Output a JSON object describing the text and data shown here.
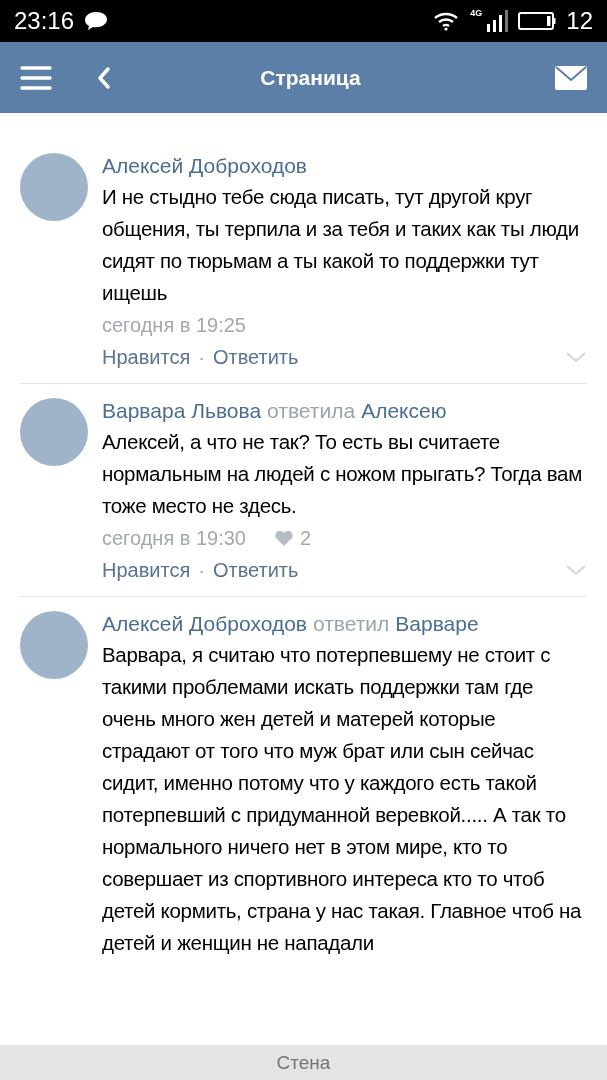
{
  "status_bar": {
    "time": "23:16",
    "network": "4G",
    "battery": "12"
  },
  "header": {
    "title": "Страница"
  },
  "comments": [
    {
      "author": "Алексей Доброходов",
      "text": "И не стыдно тебе сюда писать, тут другой круг общения, ты терпила и за тебя и таких как ты люди сидят по тюрьмам а ты какой то поддержки тут ищешь",
      "time": "сегодня в 19:25",
      "like_label": "Нравится",
      "separator": "·",
      "reply_label": "Ответить"
    },
    {
      "author": "Варвара Львова",
      "reply_verb": "ответила",
      "reply_to": "Алексею",
      "text": "Алексей, а что не так? То есть вы считаете нормальным на людей с ножом прыгать? Тогда вам тоже место не здесь.",
      "time": "сегодня в 19:30",
      "likes": "2",
      "like_label": "Нравится",
      "separator": "·",
      "reply_label": "Ответить"
    },
    {
      "author": "Алексей Доброходов",
      "reply_verb": "ответил",
      "reply_to": "Варваре",
      "text": "Варвара, я считаю что потерпевшему не стоит с такими проблемами искать поддержки там где очень много жен детей и матерей которые страдают от того что муж брат или сын сейчас сидит, именно потому что у каждого есть такой потерпевший с придуманной веревкой..... А так то нормального ничего нет в этом мире, кто то совершает из спортивного интереса кто то чтоб детей кормить, страна у нас такая. Главное чтоб на детей и женщин не нападали"
    }
  ],
  "bottom_bar": {
    "label": "Стена"
  }
}
